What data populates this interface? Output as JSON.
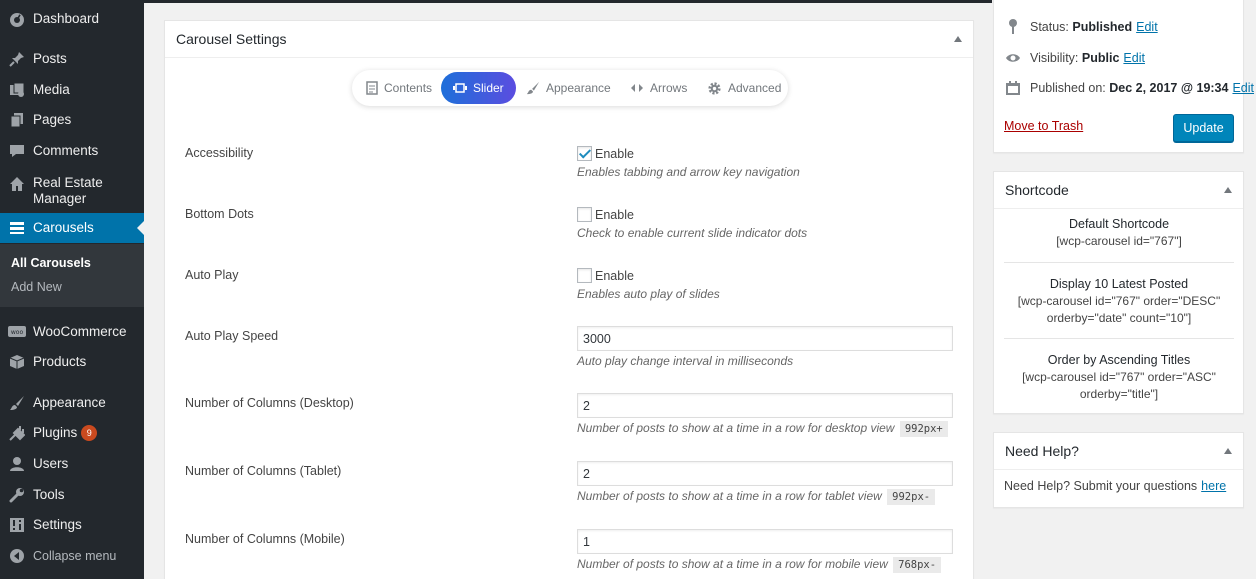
{
  "menu": {
    "items": [
      {
        "label": "Dashboard",
        "icon": "dashboard-icon"
      },
      {
        "label": "Posts",
        "icon": "pin-icon"
      },
      {
        "label": "Media",
        "icon": "media-icon"
      },
      {
        "label": "Pages",
        "icon": "pages-icon"
      },
      {
        "label": "Comments",
        "icon": "comment-icon"
      },
      {
        "label": "Real Estate Manager",
        "icon": "home-icon"
      },
      {
        "label": "Carousels",
        "icon": "carousel-icon"
      },
      {
        "label": "WooCommerce",
        "icon": "woo-icon"
      },
      {
        "label": "Products",
        "icon": "box-icon"
      },
      {
        "label": "Appearance",
        "icon": "brush-icon"
      },
      {
        "label": "Plugins",
        "icon": "plug-icon",
        "badge": "9"
      },
      {
        "label": "Users",
        "icon": "user-icon"
      },
      {
        "label": "Tools",
        "icon": "wrench-icon"
      },
      {
        "label": "Settings",
        "icon": "settings-icon"
      },
      {
        "label": "Collapse menu",
        "icon": "collapse-icon"
      }
    ],
    "submenu": [
      "All Carousels",
      "Add New"
    ]
  },
  "carousel": {
    "title": "Carousel Settings",
    "tabs": [
      "Contents",
      "Slider",
      "Appearance",
      "Arrows",
      "Advanced"
    ],
    "active_tab": "Slider",
    "fields": [
      {
        "label": "Accessibility",
        "type": "checkbox",
        "checked": true,
        "option": "Enable",
        "desc": "Enables tabbing and arrow key navigation"
      },
      {
        "label": "Bottom Dots",
        "type": "checkbox",
        "checked": false,
        "option": "Enable",
        "desc": "Check to enable current slide indicator dots"
      },
      {
        "label": "Auto Play",
        "type": "checkbox",
        "checked": false,
        "option": "Enable",
        "desc": "Enables auto play of slides"
      },
      {
        "label": "Auto Play Speed",
        "type": "text",
        "value": "3000",
        "desc": "Auto play change interval in milliseconds"
      },
      {
        "label": "Number of Columns (Desktop)",
        "type": "text",
        "value": "2",
        "desc": "Number of posts to show at a time in a row for desktop view",
        "code": "992px+"
      },
      {
        "label": "Number of Columns (Tablet)",
        "type": "text",
        "value": "2",
        "desc": "Number of posts to show at a time in a row for tablet view",
        "code": "992px-"
      },
      {
        "label": "Number of Columns (Mobile)",
        "type": "text",
        "value": "1",
        "desc": "Number of posts to show at a time in a row for mobile view",
        "code": "768px-"
      }
    ]
  },
  "publish": {
    "status_label": "Status:",
    "status_value": "Published",
    "visibility_label": "Visibility:",
    "visibility_value": "Public",
    "published_label": "Published on:",
    "published_value": "Dec 2, 2017 @ 19:34",
    "edit": "Edit",
    "trash": "Move to Trash",
    "update": "Update"
  },
  "shortcode": {
    "title": "Shortcode",
    "blocks": [
      {
        "title": "Default Shortcode",
        "line1": "[wcp-carousel id=\"767\"]",
        "line2": ""
      },
      {
        "title": "Display 10 Latest Posted",
        "line1": "[wcp-carousel id=\"767\" order=\"DESC\"",
        "line2": "orderby=\"date\" count=\"10\"]"
      },
      {
        "title": "Order by Ascending Titles",
        "line1": "[wcp-carousel id=\"767\" order=\"ASC\"",
        "line2": "orderby=\"title\"]"
      }
    ]
  },
  "help": {
    "title": "Need Help?",
    "text": "Need Help? Submit your questions",
    "link": "here"
  },
  "colors": {
    "accent": "#0073aa",
    "menu_bg": "#23282d",
    "badge": "#ca4a1f"
  }
}
